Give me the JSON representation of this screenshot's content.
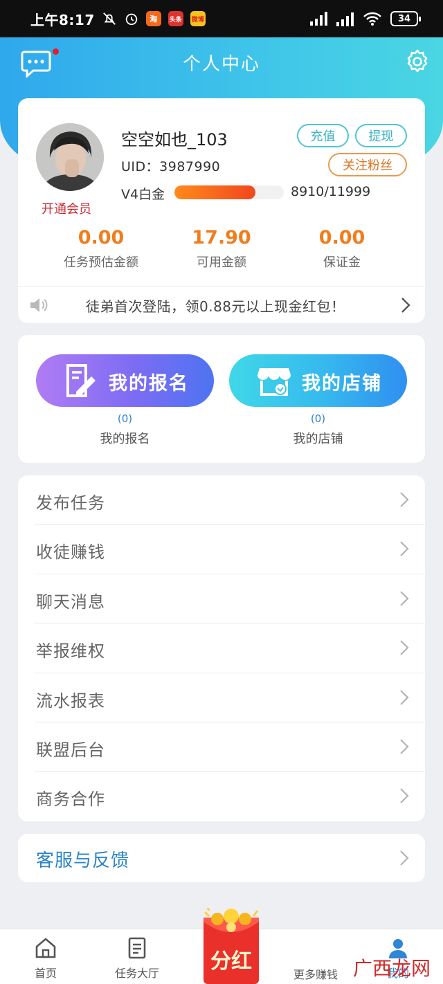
{
  "status_bar": {
    "time": "上午8:17",
    "apps": [
      "淘",
      "头条",
      "微博"
    ],
    "battery": "34"
  },
  "header": {
    "title": "个人中心",
    "has_unread": true
  },
  "profile": {
    "username": "空空如也_103",
    "uid": "UID：3987990",
    "vip_link": "开通会员",
    "recharge_label": "充值",
    "withdraw_label": "提现",
    "follow_label": "关注粉丝",
    "level": "V4白金",
    "level_progress": "8910/11999",
    "progress_fraction": 0.74,
    "stats": [
      {
        "value": "0.00",
        "label": "任务预估金额"
      },
      {
        "value": "17.90",
        "label": "可用金额"
      },
      {
        "value": "0.00",
        "label": "保证金"
      }
    ],
    "notice": "徒弟首次登陆，领0.88元以上现金红包！"
  },
  "quick": {
    "signup": {
      "label": "我的报名",
      "count": "(0)",
      "caption": "我的报名"
    },
    "store": {
      "label": "我的店铺",
      "count": "(0)",
      "caption": "我的店铺"
    }
  },
  "menu": [
    "发布任务",
    "收徒赚钱",
    "聊天消息",
    "举报维权",
    "流水报表",
    "联盟后台",
    "商务合作"
  ],
  "support": {
    "label": "客服与反馈"
  },
  "tabs": {
    "home": "首页",
    "tasks": "任务大厅",
    "bonus": "分红",
    "more": "更多赚钱",
    "mine": "我的"
  },
  "watermark": "广西龙网",
  "colors": {
    "accent": "#2fa8ec",
    "stat_orange": "#f07d1d",
    "vip_red": "#c8282f",
    "link_blue": "#2b84c8"
  }
}
